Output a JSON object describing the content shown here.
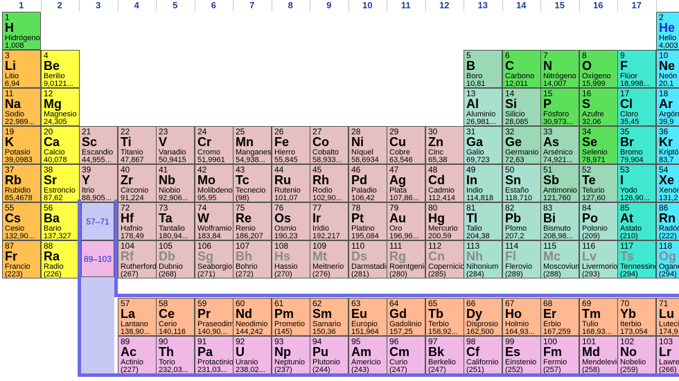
{
  "groups": [
    "1",
    "2",
    "3",
    "4",
    "5",
    "6",
    "7",
    "8",
    "9",
    "10",
    "11",
    "12",
    "13",
    "14",
    "15",
    "16",
    "17"
  ],
  "colors": {
    "alkali": "#ffc050",
    "alkaline": "#ffff44",
    "transition": "#e6c0c0",
    "post_transition": "#a8e0d0",
    "metalloid": "#9ad8b6",
    "nonmetal": "#5ce05c",
    "halogen": "#40e8d0",
    "noble": "#50e8ff",
    "lanthanide": "#ffb890",
    "actinide": "#f0b8e6"
  },
  "placeholders": {
    "lanthanides": "57–71",
    "actinides": "89–103"
  },
  "elements": [
    {
      "n": "1",
      "s": "H",
      "name": "Hidrógeno",
      "m": "1,008",
      "t": "nonmetal",
      "r": 1,
      "c": 1
    },
    {
      "n": "2",
      "s": "He",
      "name": "Helio",
      "m": "4,003",
      "t": "noble",
      "r": 1,
      "c": 18
    },
    {
      "n": "3",
      "s": "Li",
      "name": "Litio",
      "m": "6,94",
      "t": "alkali",
      "r": 2,
      "c": 1
    },
    {
      "n": "4",
      "s": "Be",
      "name": "Berilio",
      "m": "9,0121...",
      "t": "alkaline",
      "r": 2,
      "c": 2
    },
    {
      "n": "5",
      "s": "B",
      "name": "Boro",
      "m": "10,81",
      "t": "metalloid",
      "r": 2,
      "c": 13
    },
    {
      "n": "6",
      "s": "C",
      "name": "Carbono",
      "m": "12,011",
      "t": "nonmetal",
      "r": 2,
      "c": 14
    },
    {
      "n": "7",
      "s": "N",
      "name": "Nitrógeno",
      "m": "14,007",
      "t": "nonmetal",
      "r": 2,
      "c": 15
    },
    {
      "n": "8",
      "s": "O",
      "name": "Oxígeno",
      "m": "15,999",
      "t": "nonmetal",
      "r": 2,
      "c": 16
    },
    {
      "n": "9",
      "s": "F",
      "name": "Flúor",
      "m": "18,998...",
      "t": "halogen",
      "r": 2,
      "c": 17
    },
    {
      "n": "10",
      "s": "Ne",
      "name": "Neón",
      "m": "20,1",
      "t": "noble",
      "r": 2,
      "c": 18
    },
    {
      "n": "11",
      "s": "Na",
      "name": "Sodio",
      "m": "22,989...",
      "t": "alkali",
      "r": 3,
      "c": 1
    },
    {
      "n": "12",
      "s": "Mg",
      "name": "Magnesio",
      "m": "24,305",
      "t": "alkaline",
      "r": 3,
      "c": 2
    },
    {
      "n": "13",
      "s": "Al",
      "name": "Aluminio",
      "m": "26,981...",
      "t": "post_transition",
      "r": 3,
      "c": 13
    },
    {
      "n": "14",
      "s": "Si",
      "name": "Silicio",
      "m": "28,085",
      "t": "metalloid",
      "r": 3,
      "c": 14
    },
    {
      "n": "15",
      "s": "P",
      "name": "Fósforo",
      "m": "30,973...",
      "t": "nonmetal",
      "r": 3,
      "c": 15
    },
    {
      "n": "16",
      "s": "S",
      "name": "Azufre",
      "m": "32,06",
      "t": "nonmetal",
      "r": 3,
      "c": 16
    },
    {
      "n": "17",
      "s": "Cl",
      "name": "Cloro",
      "m": "35,45",
      "t": "halogen",
      "r": 3,
      "c": 17
    },
    {
      "n": "18",
      "s": "Ar",
      "name": "Argón",
      "m": "39,9",
      "t": "noble",
      "r": 3,
      "c": 18
    },
    {
      "n": "19",
      "s": "K",
      "name": "Potasio",
      "m": "39,0983",
      "t": "alkali",
      "r": 4,
      "c": 1
    },
    {
      "n": "20",
      "s": "Ca",
      "name": "Calcio",
      "m": "40,078",
      "t": "alkaline",
      "r": 4,
      "c": 2
    },
    {
      "n": "21",
      "s": "Sc",
      "name": "Escandio",
      "m": "44,955...",
      "t": "transition",
      "r": 4,
      "c": 3
    },
    {
      "n": "22",
      "s": "Ti",
      "name": "Titanio",
      "m": "47,867",
      "t": "transition",
      "r": 4,
      "c": 4
    },
    {
      "n": "23",
      "s": "V",
      "name": "Vanadio",
      "m": "50,9415",
      "t": "transition",
      "r": 4,
      "c": 5
    },
    {
      "n": "24",
      "s": "Cr",
      "name": "Cromo",
      "m": "51,9961",
      "t": "transition",
      "r": 4,
      "c": 6
    },
    {
      "n": "25",
      "s": "Mn",
      "name": "Manganeso",
      "m": "54,938...",
      "t": "transition",
      "r": 4,
      "c": 7
    },
    {
      "n": "26",
      "s": "Fe",
      "name": "Hierro",
      "m": "55,845",
      "t": "transition",
      "r": 4,
      "c": 8
    },
    {
      "n": "27",
      "s": "Co",
      "name": "Cobalto",
      "m": "58,933...",
      "t": "transition",
      "r": 4,
      "c": 9
    },
    {
      "n": "28",
      "s": "Ni",
      "name": "Níquel",
      "m": "58,6934",
      "t": "transition",
      "r": 4,
      "c": 10
    },
    {
      "n": "29",
      "s": "Cu",
      "name": "Cobre",
      "m": "63,546",
      "t": "transition",
      "r": 4,
      "c": 11
    },
    {
      "n": "30",
      "s": "Zn",
      "name": "Cinc",
      "m": "65,38",
      "t": "transition",
      "r": 4,
      "c": 12
    },
    {
      "n": "31",
      "s": "Ga",
      "name": "Galio",
      "m": "69,723",
      "t": "post_transition",
      "r": 4,
      "c": 13
    },
    {
      "n": "32",
      "s": "Ge",
      "name": "Germanio",
      "m": "72,63",
      "t": "metalloid",
      "r": 4,
      "c": 14
    },
    {
      "n": "33",
      "s": "As",
      "name": "Arsénico",
      "m": "74,921...",
      "t": "metalloid",
      "r": 4,
      "c": 15
    },
    {
      "n": "34",
      "s": "Se",
      "name": "Selenio",
      "m": "78,971",
      "t": "nonmetal",
      "r": 4,
      "c": 16
    },
    {
      "n": "35",
      "s": "Br",
      "name": "Bromo",
      "m": "79,904",
      "t": "halogen",
      "r": 4,
      "c": 17
    },
    {
      "n": "36",
      "s": "Kr",
      "name": "Kriptón",
      "m": "83,7",
      "t": "noble",
      "r": 4,
      "c": 18
    },
    {
      "n": "37",
      "s": "Rb",
      "name": "Rubidio",
      "m": "85,4678",
      "t": "alkali",
      "r": 5,
      "c": 1
    },
    {
      "n": "38",
      "s": "Sr",
      "name": "Estroncio",
      "m": "87,62",
      "t": "alkaline",
      "r": 5,
      "c": 2
    },
    {
      "n": "39",
      "s": "Y",
      "name": "Itrio",
      "m": "88,905...",
      "t": "transition",
      "r": 5,
      "c": 3
    },
    {
      "n": "40",
      "s": "Zr",
      "name": "Circonio",
      "m": "91,224",
      "t": "transition",
      "r": 5,
      "c": 4
    },
    {
      "n": "41",
      "s": "Nb",
      "name": "Niobio",
      "m": "92,906...",
      "t": "transition",
      "r": 5,
      "c": 5
    },
    {
      "n": "42",
      "s": "Mo",
      "name": "Molibdeno",
      "m": "95,95",
      "t": "transition",
      "r": 5,
      "c": 6
    },
    {
      "n": "43",
      "s": "Tc",
      "name": "Tecnecio",
      "m": "(98)",
      "t": "transition",
      "r": 5,
      "c": 7
    },
    {
      "n": "44",
      "s": "Ru",
      "name": "Rutenio",
      "m": "101,07",
      "t": "transition",
      "r": 5,
      "c": 8
    },
    {
      "n": "45",
      "s": "Rh",
      "name": "Rodio",
      "m": "102,90...",
      "t": "transition",
      "r": 5,
      "c": 9
    },
    {
      "n": "46",
      "s": "Pd",
      "name": "Paladio",
      "m": "106,42",
      "t": "transition",
      "r": 5,
      "c": 10
    },
    {
      "n": "47",
      "s": "Ag",
      "name": "Plata",
      "m": "107,86...",
      "t": "transition",
      "r": 5,
      "c": 11
    },
    {
      "n": "48",
      "s": "Cd",
      "name": "Cadmio",
      "m": "112,414",
      "t": "transition",
      "r": 5,
      "c": 12
    },
    {
      "n": "49",
      "s": "In",
      "name": "Indio",
      "m": "114,818",
      "t": "post_transition",
      "r": 5,
      "c": 13
    },
    {
      "n": "50",
      "s": "Sn",
      "name": "Estaño",
      "m": "118,710",
      "t": "post_transition",
      "r": 5,
      "c": 14
    },
    {
      "n": "51",
      "s": "Sb",
      "name": "Antimonio",
      "m": "121,760",
      "t": "metalloid",
      "r": 5,
      "c": 15
    },
    {
      "n": "52",
      "s": "Te",
      "name": "Telurio",
      "m": "127,60",
      "t": "metalloid",
      "r": 5,
      "c": 16
    },
    {
      "n": "53",
      "s": "I",
      "name": "Yodo",
      "m": "126,90...",
      "t": "halogen",
      "r": 5,
      "c": 17
    },
    {
      "n": "54",
      "s": "Xe",
      "name": "Xenón",
      "m": "131,2",
      "t": "noble",
      "r": 5,
      "c": 18
    },
    {
      "n": "55",
      "s": "Cs",
      "name": "Cesio",
      "m": "132,90...",
      "t": "alkali",
      "r": 6,
      "c": 1
    },
    {
      "n": "56",
      "s": "Ba",
      "name": "Bario",
      "m": "137,327",
      "t": "alkaline",
      "r": 6,
      "c": 2
    },
    {
      "n": "72",
      "s": "Hf",
      "name": "Hafnio",
      "m": "178,49",
      "t": "transition",
      "r": 6,
      "c": 4
    },
    {
      "n": "73",
      "s": "Ta",
      "name": "Tantalio",
      "m": "180,94...",
      "t": "transition",
      "r": 6,
      "c": 5
    },
    {
      "n": "74",
      "s": "W",
      "name": "Wolframio",
      "m": "183,84",
      "t": "transition",
      "r": 6,
      "c": 6
    },
    {
      "n": "75",
      "s": "Re",
      "name": "Renio",
      "m": "186,207",
      "t": "transition",
      "r": 6,
      "c": 7
    },
    {
      "n": "76",
      "s": "Os",
      "name": "Osmio",
      "m": "190,23",
      "t": "transition",
      "r": 6,
      "c": 8
    },
    {
      "n": "77",
      "s": "Ir",
      "name": "Iridio",
      "m": "192,217",
      "t": "transition",
      "r": 6,
      "c": 9
    },
    {
      "n": "78",
      "s": "Pt",
      "name": "Platino",
      "m": "195,084",
      "t": "transition",
      "r": 6,
      "c": 10
    },
    {
      "n": "79",
      "s": "Au",
      "name": "Oro",
      "m": "196,96...",
      "t": "transition",
      "r": 6,
      "c": 11
    },
    {
      "n": "80",
      "s": "Hg",
      "name": "Mercurio",
      "m": "200,59",
      "t": "transition",
      "r": 6,
      "c": 12
    },
    {
      "n": "81",
      "s": "Tl",
      "name": "Talio",
      "m": "204,38",
      "t": "post_transition",
      "r": 6,
      "c": 13
    },
    {
      "n": "82",
      "s": "Pb",
      "name": "Plomo",
      "m": "207,2",
      "t": "post_transition",
      "r": 6,
      "c": 14
    },
    {
      "n": "83",
      "s": "Bi",
      "name": "Bismuto",
      "m": "208,98...",
      "t": "post_transition",
      "r": 6,
      "c": 15
    },
    {
      "n": "84",
      "s": "Po",
      "name": "Polonio",
      "m": "(209)",
      "t": "post_transition",
      "r": 6,
      "c": 16
    },
    {
      "n": "85",
      "s": "At",
      "name": "Astato",
      "m": "(210)",
      "t": "halogen",
      "r": 6,
      "c": 17
    },
    {
      "n": "86",
      "s": "Rn",
      "name": "Radón",
      "m": "(222)",
      "t": "noble",
      "r": 6,
      "c": 18
    },
    {
      "n": "87",
      "s": "Fr",
      "name": "Francio",
      "m": "(223)",
      "t": "alkali",
      "r": 7,
      "c": 1
    },
    {
      "n": "88",
      "s": "Ra",
      "name": "Radio",
      "m": "(226)",
      "t": "alkaline",
      "r": 7,
      "c": 2
    },
    {
      "n": "104",
      "s": "Rf",
      "name": "Rutherfordio",
      "m": "(267)",
      "t": "transition",
      "r": 7,
      "c": 4,
      "g": 1
    },
    {
      "n": "105",
      "s": "Db",
      "name": "Dubnio",
      "m": "(268)",
      "t": "transition",
      "r": 7,
      "c": 5,
      "g": 1
    },
    {
      "n": "106",
      "s": "Sg",
      "name": "Seaborgio",
      "m": "(271)",
      "t": "transition",
      "r": 7,
      "c": 6,
      "g": 1
    },
    {
      "n": "107",
      "s": "Bh",
      "name": "Bohrio",
      "m": "(272)",
      "t": "transition",
      "r": 7,
      "c": 7,
      "g": 1
    },
    {
      "n": "108",
      "s": "Hs",
      "name": "Hassio",
      "m": "(270)",
      "t": "transition",
      "r": 7,
      "c": 8,
      "g": 1
    },
    {
      "n": "109",
      "s": "Mt",
      "name": "Meitnerio",
      "m": "(276)",
      "t": "transition",
      "r": 7,
      "c": 9,
      "g": 1
    },
    {
      "n": "110",
      "s": "Ds",
      "name": "Darmstadio",
      "m": "(281)",
      "t": "transition",
      "r": 7,
      "c": 10,
      "g": 1
    },
    {
      "n": "111",
      "s": "Rg",
      "name": "Roentgenio",
      "m": "(280)",
      "t": "transition",
      "r": 7,
      "c": 11,
      "g": 1
    },
    {
      "n": "112",
      "s": "Cn",
      "name": "Copernicio",
      "m": "(285)",
      "t": "transition",
      "r": 7,
      "c": 12,
      "g": 1
    },
    {
      "n": "113",
      "s": "Nh",
      "name": "Nihonium",
      "m": "(284)",
      "t": "post_transition",
      "r": 7,
      "c": 13,
      "g": 1
    },
    {
      "n": "114",
      "s": "Fl",
      "name": "Flerovio",
      "m": "(289)",
      "t": "post_transition",
      "r": 7,
      "c": 14,
      "g": 1
    },
    {
      "n": "115",
      "s": "Mc",
      "name": "Moscovium",
      "m": "(288)",
      "t": "post_transition",
      "r": 7,
      "c": 15,
      "g": 1
    },
    {
      "n": "116",
      "s": "Lv",
      "name": "Livermorio",
      "m": "(293)",
      "t": "post_transition",
      "r": 7,
      "c": 16,
      "g": 1
    },
    {
      "n": "117",
      "s": "Ts",
      "name": "Tennessine",
      "m": "(294)",
      "t": "halogen",
      "r": 7,
      "c": 17,
      "g": 1
    },
    {
      "n": "118",
      "s": "Og",
      "name": "Oganesón",
      "m": "(294)",
      "t": "noble",
      "r": 7,
      "c": 18,
      "g": 1
    },
    {
      "n": "57",
      "s": "La",
      "name": "Lantano",
      "m": "138,90...",
      "t": "lanthanide",
      "r": 9,
      "c": 4
    },
    {
      "n": "58",
      "s": "Ce",
      "name": "Cerio",
      "m": "140,116",
      "t": "lanthanide",
      "r": 9,
      "c": 5
    },
    {
      "n": "59",
      "s": "Pr",
      "name": "Praseodimio",
      "m": "140,90...",
      "t": "lanthanide",
      "r": 9,
      "c": 6
    },
    {
      "n": "60",
      "s": "Nd",
      "name": "Neodimio",
      "m": "144,242",
      "t": "lanthanide",
      "r": 9,
      "c": 7
    },
    {
      "n": "61",
      "s": "Pm",
      "name": "Prometio",
      "m": "(145)",
      "t": "lanthanide",
      "r": 9,
      "c": 8
    },
    {
      "n": "62",
      "s": "Sm",
      "name": "Samario",
      "m": "150,36",
      "t": "lanthanide",
      "r": 9,
      "c": 9
    },
    {
      "n": "63",
      "s": "Eu",
      "name": "Europio",
      "m": "151,964",
      "t": "lanthanide",
      "r": 9,
      "c": 10
    },
    {
      "n": "64",
      "s": "Gd",
      "name": "Gadolinio",
      "m": "157,25",
      "t": "lanthanide",
      "r": 9,
      "c": 11
    },
    {
      "n": "65",
      "s": "Tb",
      "name": "Terbio",
      "m": "158,92...",
      "t": "lanthanide",
      "r": 9,
      "c": 12
    },
    {
      "n": "66",
      "s": "Dy",
      "name": "Disprosio",
      "m": "162,500",
      "t": "lanthanide",
      "r": 9,
      "c": 13
    },
    {
      "n": "67",
      "s": "Ho",
      "name": "Holmio",
      "m": "164,93...",
      "t": "lanthanide",
      "r": 9,
      "c": 14
    },
    {
      "n": "68",
      "s": "Er",
      "name": "Erbio",
      "m": "167,259",
      "t": "lanthanide",
      "r": 9,
      "c": 15
    },
    {
      "n": "69",
      "s": "Tm",
      "name": "Tulio",
      "m": "168,93...",
      "t": "lanthanide",
      "r": 9,
      "c": 16
    },
    {
      "n": "70",
      "s": "Yb",
      "name": "Iterbio",
      "m": "173,054",
      "t": "lanthanide",
      "r": 9,
      "c": 17
    },
    {
      "n": "71",
      "s": "Lu",
      "name": "Lutecio",
      "m": "174,9",
      "t": "lanthanide",
      "r": 9,
      "c": 18
    },
    {
      "n": "89",
      "s": "Ac",
      "name": "Actinio",
      "m": "(227)",
      "t": "actinide",
      "r": 10,
      "c": 4
    },
    {
      "n": "90",
      "s": "Th",
      "name": "Torio",
      "m": "232,03...",
      "t": "actinide",
      "r": 10,
      "c": 5
    },
    {
      "n": "91",
      "s": "Pa",
      "name": "Protactinio",
      "m": "231,03...",
      "t": "actinide",
      "r": 10,
      "c": 6
    },
    {
      "n": "92",
      "s": "U",
      "name": "Uranio",
      "m": "238,02...",
      "t": "actinide",
      "r": 10,
      "c": 7
    },
    {
      "n": "93",
      "s": "Np",
      "name": "Neptunio",
      "m": "(237)",
      "t": "actinide",
      "r": 10,
      "c": 8
    },
    {
      "n": "94",
      "s": "Pu",
      "name": "Plutonio",
      "m": "(244)",
      "t": "actinide",
      "r": 10,
      "c": 9
    },
    {
      "n": "95",
      "s": "Am",
      "name": "Americio",
      "m": "(243)",
      "t": "actinide",
      "r": 10,
      "c": 10
    },
    {
      "n": "96",
      "s": "Cm",
      "name": "Curio",
      "m": "(247)",
      "t": "actinide",
      "r": 10,
      "c": 11
    },
    {
      "n": "97",
      "s": "Bk",
      "name": "Berkelio",
      "m": "(247)",
      "t": "actinide",
      "r": 10,
      "c": 12
    },
    {
      "n": "98",
      "s": "Cf",
      "name": "Californio",
      "m": "(251)",
      "t": "actinide",
      "r": 10,
      "c": 13
    },
    {
      "n": "99",
      "s": "Es",
      "name": "Einstenio",
      "m": "(252)",
      "t": "actinide",
      "r": 10,
      "c": 14
    },
    {
      "n": "100",
      "s": "Fm",
      "name": "Fermio",
      "m": "(257)",
      "t": "actinide",
      "r": 10,
      "c": 15
    },
    {
      "n": "101",
      "s": "Md",
      "name": "Mendelevio",
      "m": "(258)",
      "t": "actinide",
      "r": 10,
      "c": 16
    },
    {
      "n": "102",
      "s": "No",
      "name": "Nobelio",
      "m": "(259)",
      "t": "actinide",
      "r": 10,
      "c": 17
    },
    {
      "n": "103",
      "s": "Lr",
      "name": "Lawrencio",
      "m": "(266)",
      "t": "actinide",
      "r": 10,
      "c": 18
    }
  ]
}
